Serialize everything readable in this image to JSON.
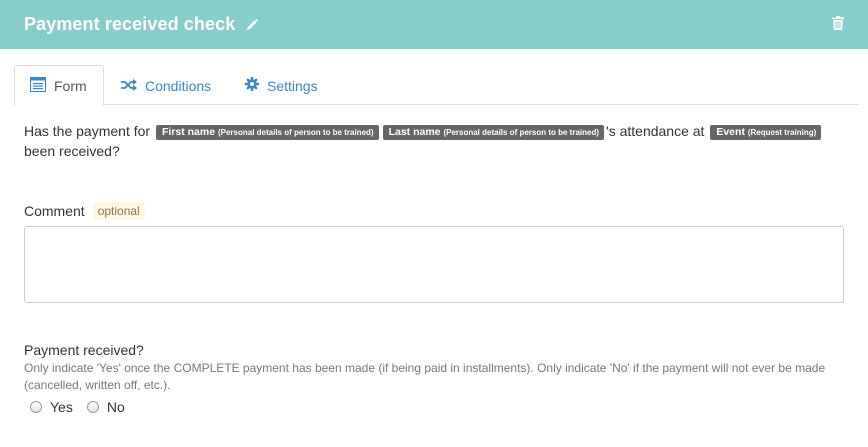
{
  "header": {
    "title": "Payment received check",
    "color": "#86cdcb"
  },
  "tabs": [
    {
      "label": "Form",
      "icon": "form-list-icon",
      "active": true
    },
    {
      "label": "Conditions",
      "icon": "shuffle-icon",
      "active": false
    },
    {
      "label": "Settings",
      "icon": "gear-icon",
      "active": false
    }
  ],
  "question": {
    "prefix": "Has the payment for",
    "tags": [
      {
        "field": "First name",
        "source": "(Personal details of person to be trained)"
      },
      {
        "field": "Last name",
        "source": "(Personal details of person to be trained)"
      },
      {
        "field": "Event",
        "source": "(Request training)"
      }
    ],
    "middle": "'s attendance at",
    "suffix": "been received?"
  },
  "comment": {
    "label": "Comment",
    "optional_badge": "optional",
    "value": ""
  },
  "payment_received": {
    "label": "Payment received?",
    "help": "Only indicate 'Yes' once the COMPLETE payment has been made (if being paid in installments). Only indicate 'No' if the payment will not ever be made (cancelled, written off, etc.).",
    "options": [
      "Yes",
      "No"
    ],
    "selected": null
  }
}
